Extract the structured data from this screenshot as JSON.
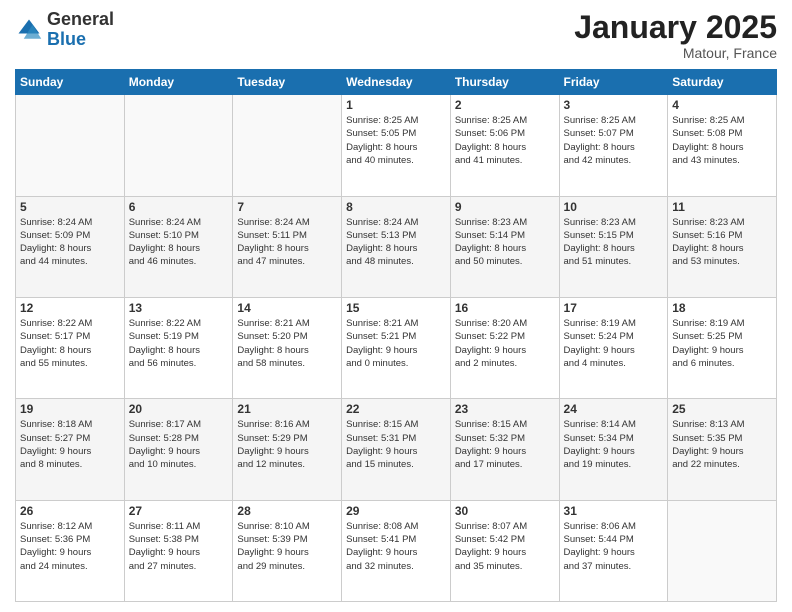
{
  "logo": {
    "general": "General",
    "blue": "Blue"
  },
  "header": {
    "month": "January 2025",
    "location": "Matour, France"
  },
  "weekdays": [
    "Sunday",
    "Monday",
    "Tuesday",
    "Wednesday",
    "Thursday",
    "Friday",
    "Saturday"
  ],
  "weeks": [
    [
      {
        "day": "",
        "info": ""
      },
      {
        "day": "",
        "info": ""
      },
      {
        "day": "",
        "info": ""
      },
      {
        "day": "1",
        "info": "Sunrise: 8:25 AM\nSunset: 5:05 PM\nDaylight: 8 hours\nand 40 minutes."
      },
      {
        "day": "2",
        "info": "Sunrise: 8:25 AM\nSunset: 5:06 PM\nDaylight: 8 hours\nand 41 minutes."
      },
      {
        "day": "3",
        "info": "Sunrise: 8:25 AM\nSunset: 5:07 PM\nDaylight: 8 hours\nand 42 minutes."
      },
      {
        "day": "4",
        "info": "Sunrise: 8:25 AM\nSunset: 5:08 PM\nDaylight: 8 hours\nand 43 minutes."
      }
    ],
    [
      {
        "day": "5",
        "info": "Sunrise: 8:24 AM\nSunset: 5:09 PM\nDaylight: 8 hours\nand 44 minutes."
      },
      {
        "day": "6",
        "info": "Sunrise: 8:24 AM\nSunset: 5:10 PM\nDaylight: 8 hours\nand 46 minutes."
      },
      {
        "day": "7",
        "info": "Sunrise: 8:24 AM\nSunset: 5:11 PM\nDaylight: 8 hours\nand 47 minutes."
      },
      {
        "day": "8",
        "info": "Sunrise: 8:24 AM\nSunset: 5:13 PM\nDaylight: 8 hours\nand 48 minutes."
      },
      {
        "day": "9",
        "info": "Sunrise: 8:23 AM\nSunset: 5:14 PM\nDaylight: 8 hours\nand 50 minutes."
      },
      {
        "day": "10",
        "info": "Sunrise: 8:23 AM\nSunset: 5:15 PM\nDaylight: 8 hours\nand 51 minutes."
      },
      {
        "day": "11",
        "info": "Sunrise: 8:23 AM\nSunset: 5:16 PM\nDaylight: 8 hours\nand 53 minutes."
      }
    ],
    [
      {
        "day": "12",
        "info": "Sunrise: 8:22 AM\nSunset: 5:17 PM\nDaylight: 8 hours\nand 55 minutes."
      },
      {
        "day": "13",
        "info": "Sunrise: 8:22 AM\nSunset: 5:19 PM\nDaylight: 8 hours\nand 56 minutes."
      },
      {
        "day": "14",
        "info": "Sunrise: 8:21 AM\nSunset: 5:20 PM\nDaylight: 8 hours\nand 58 minutes."
      },
      {
        "day": "15",
        "info": "Sunrise: 8:21 AM\nSunset: 5:21 PM\nDaylight: 9 hours\nand 0 minutes."
      },
      {
        "day": "16",
        "info": "Sunrise: 8:20 AM\nSunset: 5:22 PM\nDaylight: 9 hours\nand 2 minutes."
      },
      {
        "day": "17",
        "info": "Sunrise: 8:19 AM\nSunset: 5:24 PM\nDaylight: 9 hours\nand 4 minutes."
      },
      {
        "day": "18",
        "info": "Sunrise: 8:19 AM\nSunset: 5:25 PM\nDaylight: 9 hours\nand 6 minutes."
      }
    ],
    [
      {
        "day": "19",
        "info": "Sunrise: 8:18 AM\nSunset: 5:27 PM\nDaylight: 9 hours\nand 8 minutes."
      },
      {
        "day": "20",
        "info": "Sunrise: 8:17 AM\nSunset: 5:28 PM\nDaylight: 9 hours\nand 10 minutes."
      },
      {
        "day": "21",
        "info": "Sunrise: 8:16 AM\nSunset: 5:29 PM\nDaylight: 9 hours\nand 12 minutes."
      },
      {
        "day": "22",
        "info": "Sunrise: 8:15 AM\nSunset: 5:31 PM\nDaylight: 9 hours\nand 15 minutes."
      },
      {
        "day": "23",
        "info": "Sunrise: 8:15 AM\nSunset: 5:32 PM\nDaylight: 9 hours\nand 17 minutes."
      },
      {
        "day": "24",
        "info": "Sunrise: 8:14 AM\nSunset: 5:34 PM\nDaylight: 9 hours\nand 19 minutes."
      },
      {
        "day": "25",
        "info": "Sunrise: 8:13 AM\nSunset: 5:35 PM\nDaylight: 9 hours\nand 22 minutes."
      }
    ],
    [
      {
        "day": "26",
        "info": "Sunrise: 8:12 AM\nSunset: 5:36 PM\nDaylight: 9 hours\nand 24 minutes."
      },
      {
        "day": "27",
        "info": "Sunrise: 8:11 AM\nSunset: 5:38 PM\nDaylight: 9 hours\nand 27 minutes."
      },
      {
        "day": "28",
        "info": "Sunrise: 8:10 AM\nSunset: 5:39 PM\nDaylight: 9 hours\nand 29 minutes."
      },
      {
        "day": "29",
        "info": "Sunrise: 8:08 AM\nSunset: 5:41 PM\nDaylight: 9 hours\nand 32 minutes."
      },
      {
        "day": "30",
        "info": "Sunrise: 8:07 AM\nSunset: 5:42 PM\nDaylight: 9 hours\nand 35 minutes."
      },
      {
        "day": "31",
        "info": "Sunrise: 8:06 AM\nSunset: 5:44 PM\nDaylight: 9 hours\nand 37 minutes."
      },
      {
        "day": "",
        "info": ""
      }
    ]
  ]
}
